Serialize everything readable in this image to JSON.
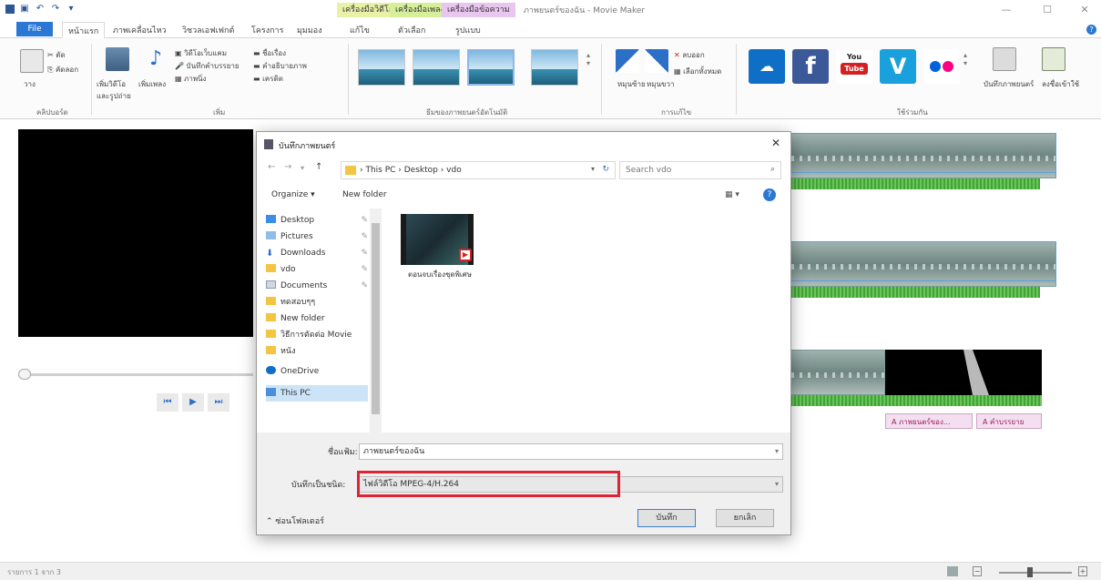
{
  "titlebar": {
    "quick_access": [
      "save-icon",
      "undo-icon",
      "redo-icon",
      "dropdown-icon"
    ],
    "context_tabs": [
      "เครื่องมือวิดีโอ",
      "เครื่องมือเพลง",
      "เครื่องมือข้อความ"
    ],
    "window_title": "ภาพยนตร์ของฉัน - Movie Maker",
    "controls": [
      "—",
      "☐",
      "✕"
    ]
  },
  "ribbon_tabs": {
    "file": "File",
    "tabs": [
      "หน้าแรก",
      "ภาพเคลื่อนไหว",
      "วิชวลเอฟเฟกต์",
      "โครงการ",
      "มุมมอง",
      "แก้ไข",
      "ตัวเลือก",
      "รูปแบบ"
    ]
  },
  "ribbon": {
    "clipboard": {
      "paste": "วาง",
      "cut": "ตัด",
      "copy": "คัดลอก",
      "group_label": "คลิปบอร์ด"
    },
    "add": {
      "add_videos": "เพิ่มวิดีโอและรูปถ่าย",
      "add_music": "เพิ่มเพลง",
      "webcam": "วิดีโอเว็บแคม",
      "narration": "บันทึกคำบรรยาย",
      "snapshot": "ภาพนิ่ง",
      "title": "ชื่อเรื่อง",
      "caption": "คำอธิบายภาพ",
      "credits": "เครดิต",
      "group_label": "เพิ่ม"
    },
    "themes_label": "ธีมของภาพยนตร์อัตโนมัติ",
    "editing": {
      "rotate_left": "หมุนซ้าย",
      "rotate_right": "หมุนขวา",
      "remove": "ลบออก",
      "select_all": "เลือกทั้งหมด",
      "group_label": "การแก้ไข"
    },
    "share": {
      "items": [
        "onedrive-icon",
        "facebook-icon",
        "youtube-icon",
        "vimeo-icon",
        "flickr-icon"
      ],
      "save_movie": "บันทึกภาพยนตร์",
      "sign_in": "ลงชื่อเข้าใช้",
      "group_label": "ใช้ร่วมกัน"
    }
  },
  "player": {
    "controls": [
      "⏮",
      "▶",
      "⏭"
    ]
  },
  "timeline": {
    "captions": [
      "A ภาพยนตร์ของ...",
      "A คำบรรยาย"
    ]
  },
  "statusbar": {
    "text": "รายการ 1 จาก 3"
  },
  "dialog": {
    "title": "บันทึกภาพยนตร์",
    "address": "› This PC › Desktop › vdo",
    "search_placeholder": "Search vdo",
    "organize": "Organize ▾",
    "new_folder": "New folder",
    "nav_items": [
      {
        "label": "Desktop",
        "pinned": true
      },
      {
        "label": "Pictures",
        "pinned": true
      },
      {
        "label": "Downloads",
        "pinned": true
      },
      {
        "label": "vdo",
        "pinned": true
      },
      {
        "label": "Documents",
        "pinned": true
      },
      {
        "label": "ทดสอบๆๆ",
        "pinned": false
      },
      {
        "label": "New folder",
        "pinned": false
      },
      {
        "label": "วิธีการตัดต่อ Movie",
        "pinned": false
      },
      {
        "label": "หนัง",
        "pinned": false
      },
      {
        "label": "OneDrive",
        "pinned": false
      },
      {
        "label": "This PC",
        "pinned": false,
        "selected": true
      }
    ],
    "file_name_label": "ชื่อแฟ้ม:",
    "file_name_value": "ภาพยนตร์ของฉัน",
    "save_type_label": "บันทึกเป็นชนิด:",
    "save_type_value": "ไฟล์วิดีโอ MPEG-4/H.264",
    "hide_folders": "ซ่อนโฟลเดอร์",
    "save_button": "บันทึก",
    "cancel_button": "ยกเลิก",
    "files": [
      {
        "name": "ตอนจบเรื่องชุดพิเศษ"
      }
    ]
  },
  "colors": {
    "accent": "#2b78d4",
    "highlight": "#e02433",
    "video_tools": "#e9f1a6",
    "music_tools": "#d6ef9a",
    "text_tools": "#e8c6ef"
  }
}
